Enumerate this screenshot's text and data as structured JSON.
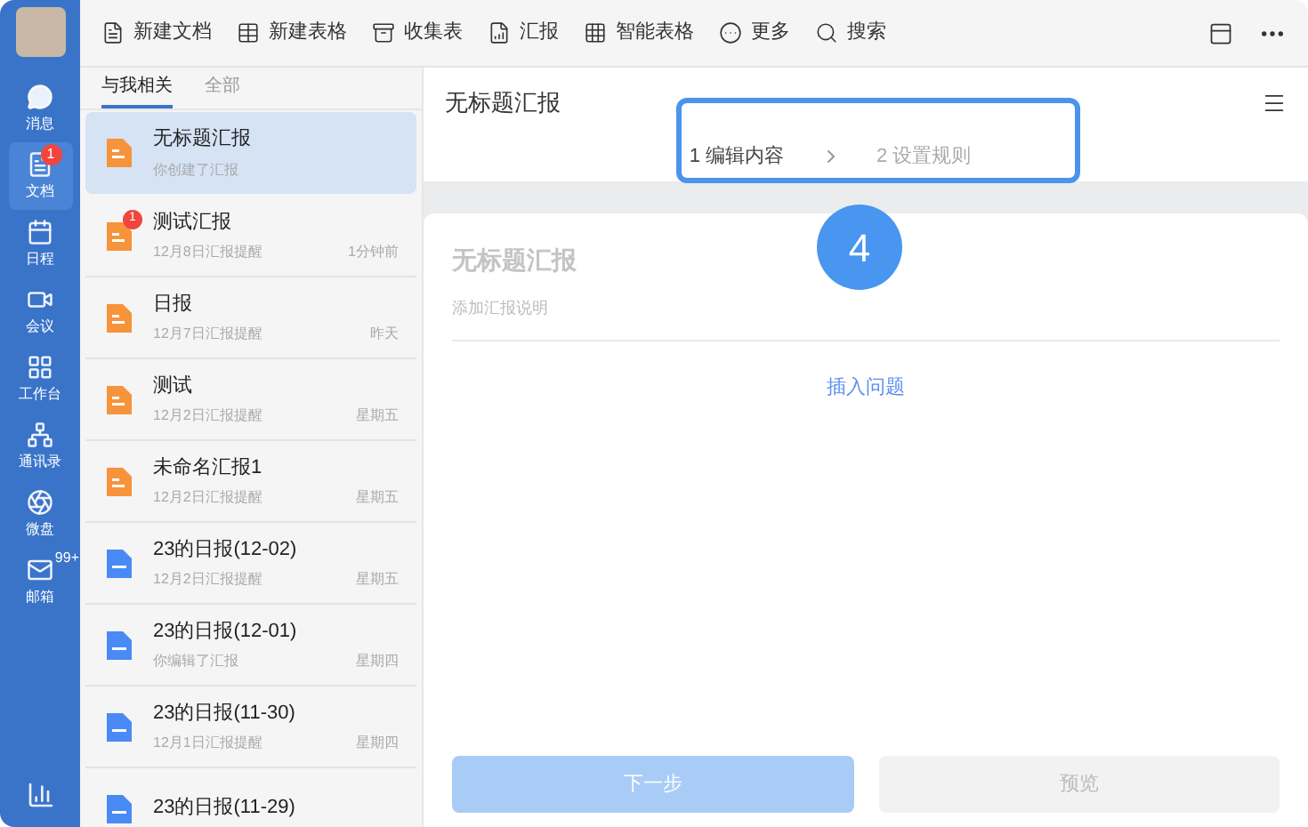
{
  "nav": [
    {
      "label": "消息",
      "selected": false
    },
    {
      "label": "文档",
      "selected": true,
      "badge": "1"
    },
    {
      "label": "日程",
      "selected": false
    },
    {
      "label": "会议",
      "selected": false
    },
    {
      "label": "工作台",
      "selected": false
    },
    {
      "label": "通讯录",
      "selected": false
    },
    {
      "label": "微盘",
      "selected": false
    },
    {
      "label": "邮箱",
      "selected": false,
      "count": "99+"
    }
  ],
  "toolbar": [
    "新建文档",
    "新建表格",
    "收集表",
    "汇报",
    "智能表格",
    "更多",
    "搜索"
  ],
  "tabs": [
    {
      "label": "与我相关",
      "selected": true
    },
    {
      "label": "全部",
      "selected": false
    }
  ],
  "items": [
    {
      "kind": "report",
      "title": "无标题汇报",
      "subtitle": "你创建了汇报",
      "selected": true
    },
    {
      "kind": "report",
      "title": "测试汇报",
      "subtitle": "12月8日汇报提醒",
      "time": "1分钟前",
      "badge": "1",
      "selected": false
    },
    {
      "kind": "report",
      "title": "日报",
      "subtitle": "12月7日汇报提醒",
      "time": "昨天",
      "selected": false
    },
    {
      "kind": "report",
      "title": "测试",
      "subtitle": "12月2日汇报提醒",
      "time": "星期五",
      "selected": false
    },
    {
      "kind": "report",
      "title": "未命名汇报1",
      "subtitle": "12月2日汇报提醒",
      "time": "星期五",
      "selected": false
    },
    {
      "kind": "daily",
      "title": "23的日报(12-02)",
      "subtitle": "12月2日汇报提醒",
      "time": "星期五",
      "selected": false
    },
    {
      "kind": "daily",
      "title": "23的日报(12-01)",
      "subtitle": "你编辑了汇报",
      "time": "星期四",
      "selected": false
    },
    {
      "kind": "daily",
      "title": "23的日报(11-30)",
      "subtitle": "12月1日汇报提醒",
      "time": "星期四",
      "selected": false
    },
    {
      "kind": "daily",
      "title": "23的日报(11-29)",
      "selected": false
    }
  ],
  "editor": {
    "title": "无标题汇报",
    "steps": [
      {
        "label": "1 编辑内容",
        "selected": true
      },
      {
        "label": "2 设置规则",
        "selected": false
      }
    ],
    "step_marker": "4",
    "form_title": "无标题汇报",
    "description_placeholder": "添加汇报说明",
    "insert_link": "插入问题",
    "buttons": [
      {
        "label": "下一步",
        "kind": "primary",
        "disabled": true
      },
      {
        "label": "预览",
        "kind": "secondary",
        "disabled": true
      }
    ]
  }
}
